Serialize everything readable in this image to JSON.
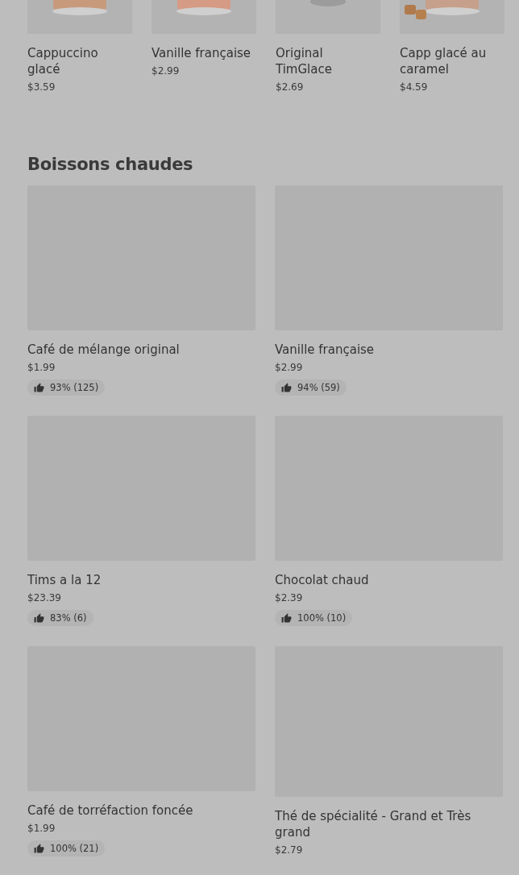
{
  "featured": [
    {
      "name": "Cappuccino glacé",
      "price": "$3.59",
      "kind": "picture"
    },
    {
      "name": "Vanille française",
      "price": "$2.99",
      "kind": "picture"
    },
    {
      "name": "Original TimGlace",
      "price": "$2.69",
      "kind": "picture"
    },
    {
      "name": "Capp glacé au caramel",
      "price": "$4.59",
      "kind": "picture"
    }
  ],
  "section": {
    "title": "Boissons chaudes",
    "items": [
      {
        "name": "Café de mélange original",
        "price": "$1.99",
        "rating": "93% (125)"
      },
      {
        "name": "Vanille française",
        "price": "$2.99",
        "rating": "94% (59)"
      },
      {
        "name": "Tims a la 12",
        "price": "$23.39",
        "rating": "83% (6)"
      },
      {
        "name": "Chocolat chaud",
        "price": "$2.39",
        "rating": "100% (10)"
      },
      {
        "name": "Café de torréfaction foncée",
        "price": "$1.99",
        "rating": "100% (21)"
      },
      {
        "name": "Thé de spécialité - Grand et Très grand",
        "price": "$2.79"
      }
    ]
  }
}
